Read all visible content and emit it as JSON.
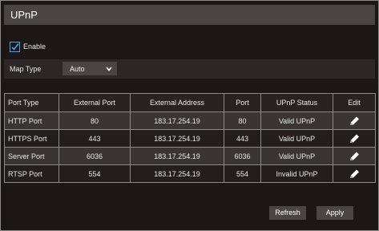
{
  "window": {
    "title": "UPnP"
  },
  "enable": {
    "label": "Enable",
    "checked": true
  },
  "map_type": {
    "label": "Map Type",
    "value": "Auto"
  },
  "table": {
    "columns": [
      "Port Type",
      "External Port",
      "External Address",
      "Port",
      "UPnP Status",
      "Edit"
    ],
    "rows": [
      {
        "port_type": "HTTP Port",
        "external_port": "80",
        "external_address": "183.17.254.19",
        "port": "80",
        "status": "Valid UPnP"
      },
      {
        "port_type": "HTTPS Port",
        "external_port": "443",
        "external_address": "183.17.254.19",
        "port": "443",
        "status": "Valid UPnP"
      },
      {
        "port_type": "Server Port",
        "external_port": "6036",
        "external_address": "183.17.254.19",
        "port": "6036",
        "status": "Valid UPnP"
      },
      {
        "port_type": "RTSP Port",
        "external_port": "554",
        "external_address": "183.17.254.19",
        "port": "554",
        "status": "Invalid UPnP"
      }
    ]
  },
  "buttons": {
    "refresh": "Refresh",
    "apply": "Apply"
  },
  "icons": {
    "edit": "pencil-icon",
    "dropdown": "chevron-down-icon",
    "check": "checkmark-icon"
  },
  "colors": {
    "background": "#1c1616",
    "titlebar": "#4a4444",
    "checkbox_accent": "#4aa3e6"
  }
}
